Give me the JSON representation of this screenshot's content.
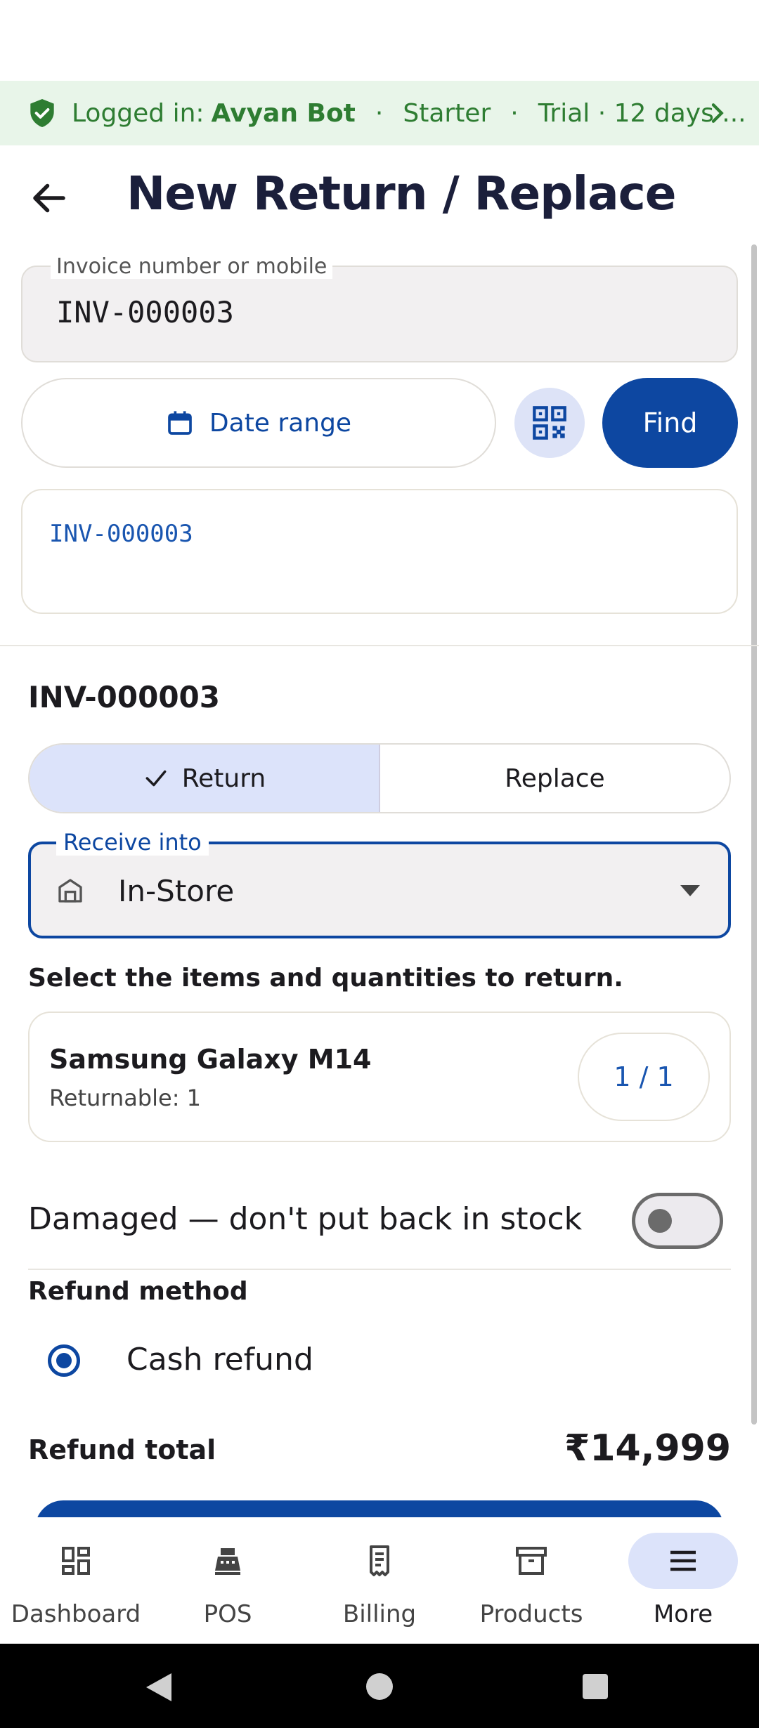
{
  "banner": {
    "prefix": "Logged in:",
    "user": "Avyan Bot",
    "sep1": "·",
    "plan": "Starter",
    "sep2": "·",
    "trial": "Trial · 12 days ...",
    "color": "#2e7d32"
  },
  "header": {
    "title": "New Return / Replace"
  },
  "search": {
    "label": "Invoice number or mobile",
    "value": "INV-000003",
    "date_range_label": "Date range",
    "find_label": "Find"
  },
  "suggestions": [
    "INV-000003"
  ],
  "invoice": {
    "number": "INV-000003"
  },
  "mode": {
    "options": [
      "Return",
      "Replace"
    ],
    "selected": "Return"
  },
  "receive_into": {
    "label": "Receive into",
    "value": "In-Store"
  },
  "items_instruction": "Select the items and quantities to return.",
  "items": [
    {
      "name": "Samsung Galaxy M14",
      "returnable": "Returnable: 1",
      "quantity": "1 / 1"
    }
  ],
  "damaged": {
    "label": "Damaged — don't put back in stock",
    "enabled": false
  },
  "refund": {
    "method_heading": "Refund method",
    "method_label": "Cash refund",
    "selected": true,
    "total_label": "Refund total",
    "total_value": "₹14,999"
  },
  "bottom_nav": [
    {
      "label": "Dashboard",
      "icon": "dashboard-icon"
    },
    {
      "label": "POS",
      "icon": "pos-icon"
    },
    {
      "label": "Billing",
      "icon": "receipt-icon"
    },
    {
      "label": "Products",
      "icon": "archive-icon"
    },
    {
      "label": "More",
      "icon": "menu-icon",
      "active": true
    }
  ],
  "colors": {
    "primary": "#0d47a1",
    "banner_bg": "#e8f5e9",
    "selected_bg": "#dce3fa"
  }
}
